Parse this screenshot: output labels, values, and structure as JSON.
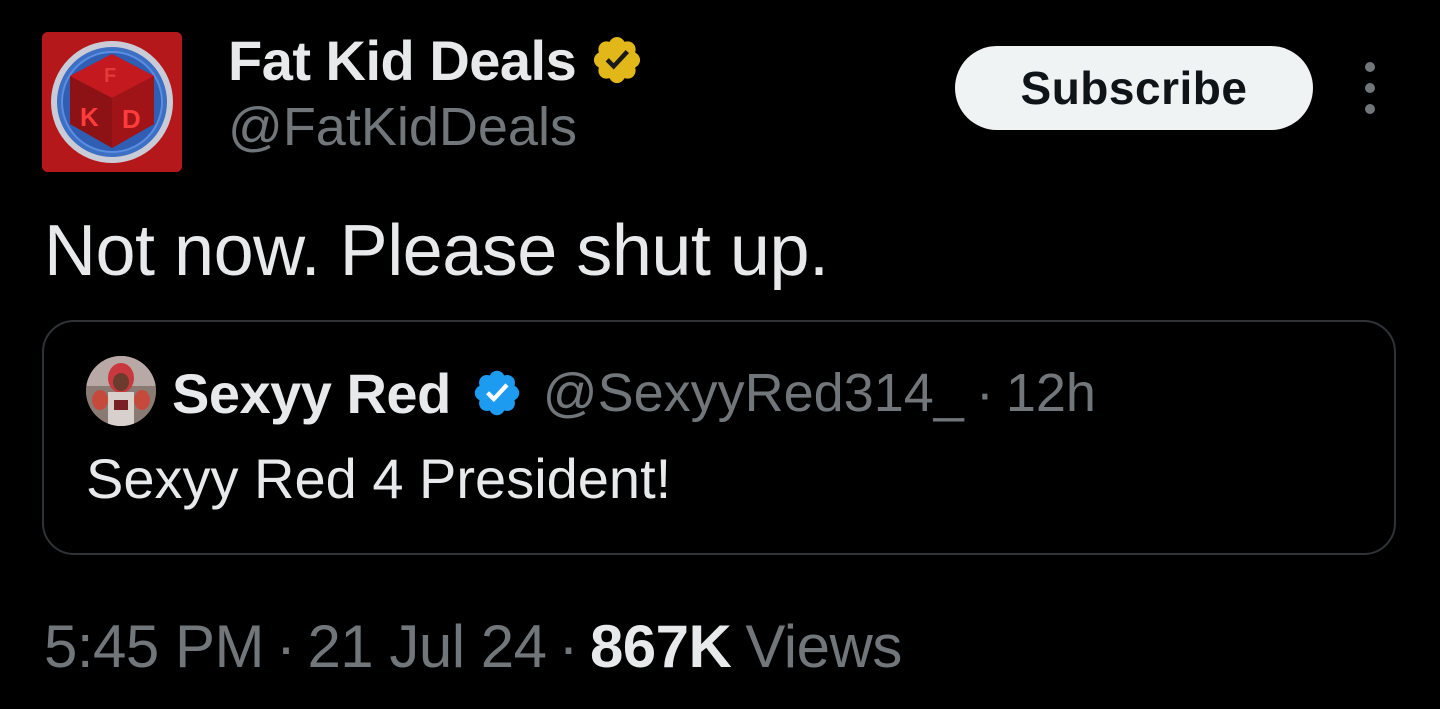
{
  "author": {
    "display_name": "Fat Kid Deals",
    "handle": "@FatKidDeals",
    "verified_badge": "gold-verified-badge-icon",
    "avatar_logo_text": "FKD"
  },
  "actions": {
    "subscribe_label": "Subscribe",
    "more_icon": "more-vertical-icon"
  },
  "tweet": {
    "text": "Not now. Please shut up."
  },
  "quoted_tweet": {
    "display_name": "Sexyy Red",
    "verified_badge": "blue-verified-badge-icon",
    "handle": "@SexyyRed314_",
    "separator": "·",
    "time": "12h",
    "text": "Sexyy Red 4 President!"
  },
  "meta": {
    "time": "5:45 PM",
    "separator": "·",
    "date": "21 Jul 24",
    "views_count": "867K",
    "views_label": "Views"
  },
  "colors": {
    "background": "#000000",
    "primary_text": "#e7e9ea",
    "secondary_text": "#71767b",
    "border": "#2f3336",
    "button_bg": "#eff3f4",
    "gold_badge": "#e2b719",
    "blue_badge": "#1d9bf0",
    "avatar_red": "#b4181b"
  }
}
